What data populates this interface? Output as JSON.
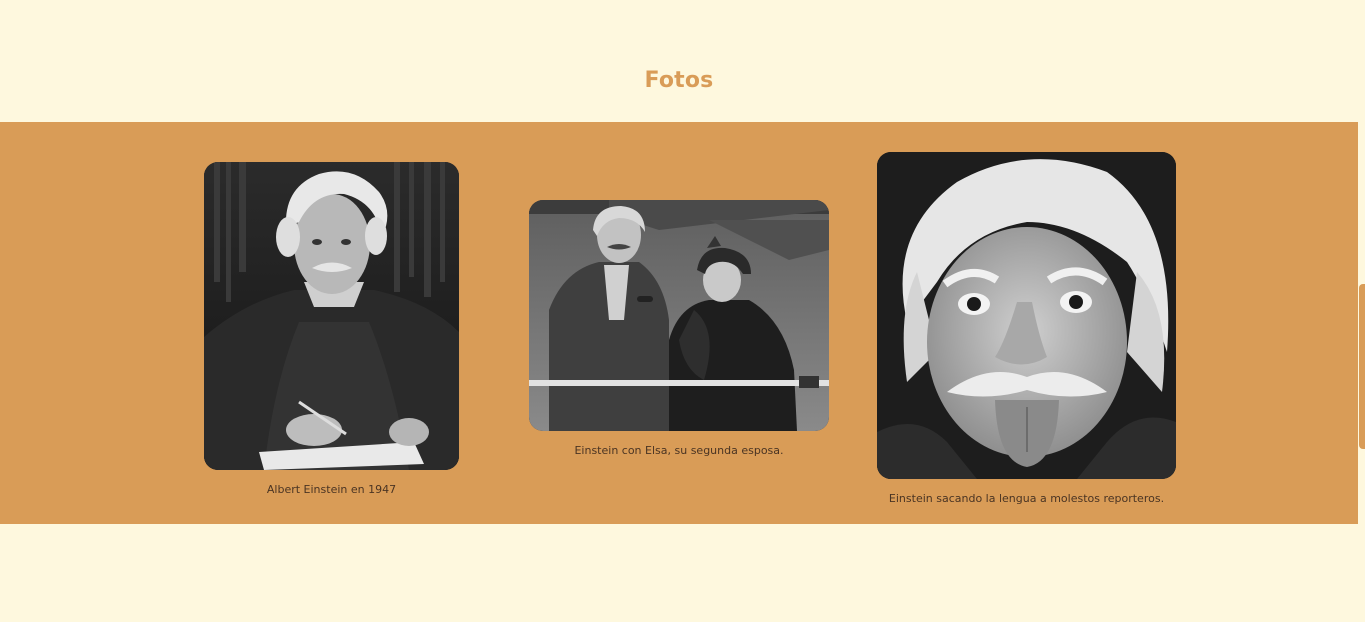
{
  "section": {
    "title": "Fotos"
  },
  "photos": [
    {
      "icon": "einstein-portrait-writing-photo",
      "caption": "Albert Einstein en 1947"
    },
    {
      "icon": "einstein-and-elsa-photo",
      "caption": "Einstein con Elsa, su segunda esposa."
    },
    {
      "icon": "einstein-tongue-out-photo",
      "caption": "Einstein sacando la lengua a molestos reporteros."
    }
  ],
  "colors": {
    "page_background": "#fef8de",
    "band_background": "#d99c57",
    "title_color": "#d99c57",
    "caption_color": "#4a3423",
    "scroll_tab_color": "#d99c57"
  }
}
